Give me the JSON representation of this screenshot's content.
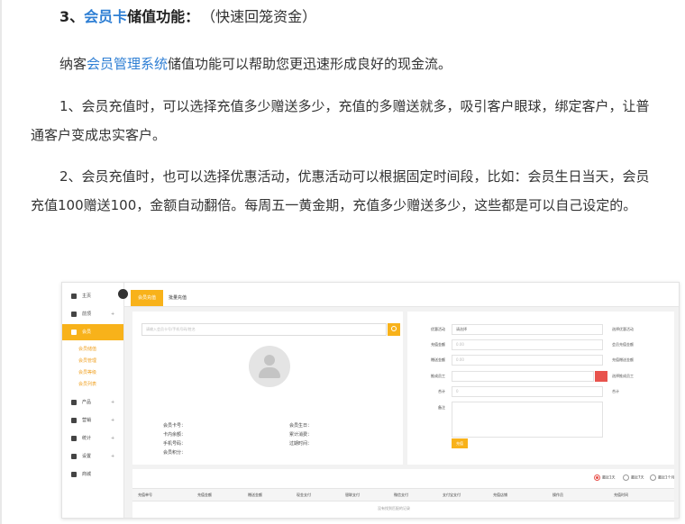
{
  "article": {
    "heading_num": "3、",
    "heading_link": "会员卡",
    "heading_rest": "储值功能：",
    "heading_note": "（快速回笼资金）",
    "p1_pre": "纳客",
    "p1_link": "会员管理系统",
    "p1_post": "储值功能可以帮助您更迅速形成良好的现金流。",
    "p2": "1、会员充值时，可以选择充值多少赠送多少，充值的多赠送就多，吸引客户眼球，绑定客户，让普通客户变成忠实客户。",
    "p3": "2、会员充值时，也可以选择优惠活动，优惠活动可以根据固定时间段，比如：会员生日当天，会员充值100赠送100，金额自动翻倍。每周五一黄金期，充值多少赠送多少，这些都是可以自己设定的。"
  },
  "shot": {
    "accent": "#f8b21a",
    "sidebar": {
      "home": "主页",
      "i2": "前顶",
      "i3": "会员",
      "subs": [
        "会员储值",
        "会员管理",
        "会员等级",
        "会员列表"
      ],
      "product": "产品",
      "i5": "营销",
      "stats": "统计",
      "settings": "设置",
      "shop": "商城",
      "plus": "+"
    },
    "tabs": {
      "active": "会员充值",
      "other": "批量充值"
    },
    "search_placeholder": "请输入会员卡号/手机号码/姓名",
    "info": {
      "card_no": "会员卡号：",
      "balance": "卡内余额：",
      "phone": "手机号码：",
      "points": "会员积分：",
      "birthday": "会员生日：",
      "total": "累计消费：",
      "expire": "过期时间："
    },
    "form": {
      "promo_label": "优惠活动",
      "promo_value": "请选择",
      "promo_hint": "选择优惠活动",
      "recharge_label": "充值金额",
      "recharge_value": "0.00",
      "recharge_hint": "会员充值金额",
      "gift_label": "赠送金额",
      "gift_value": "0.00",
      "gift_hint": "充值赠送金额",
      "staff_label": "推成员工",
      "staff_hint": "选择推成员工",
      "sum_label": "合计",
      "sum_value": "0",
      "sum_hint": "合计",
      "remark_label": "备注",
      "ok": "充值"
    },
    "filters": [
      "最近1天",
      "最近7天",
      "最近1个月"
    ],
    "columns": [
      "充值单号",
      "充值金额",
      "赠送金额",
      "现金支付",
      "银联支付",
      "微信支付",
      "支付宝支付",
      "充值店铺",
      "操作员",
      "充值时间"
    ],
    "empty": "没有找到匹配的记录"
  }
}
